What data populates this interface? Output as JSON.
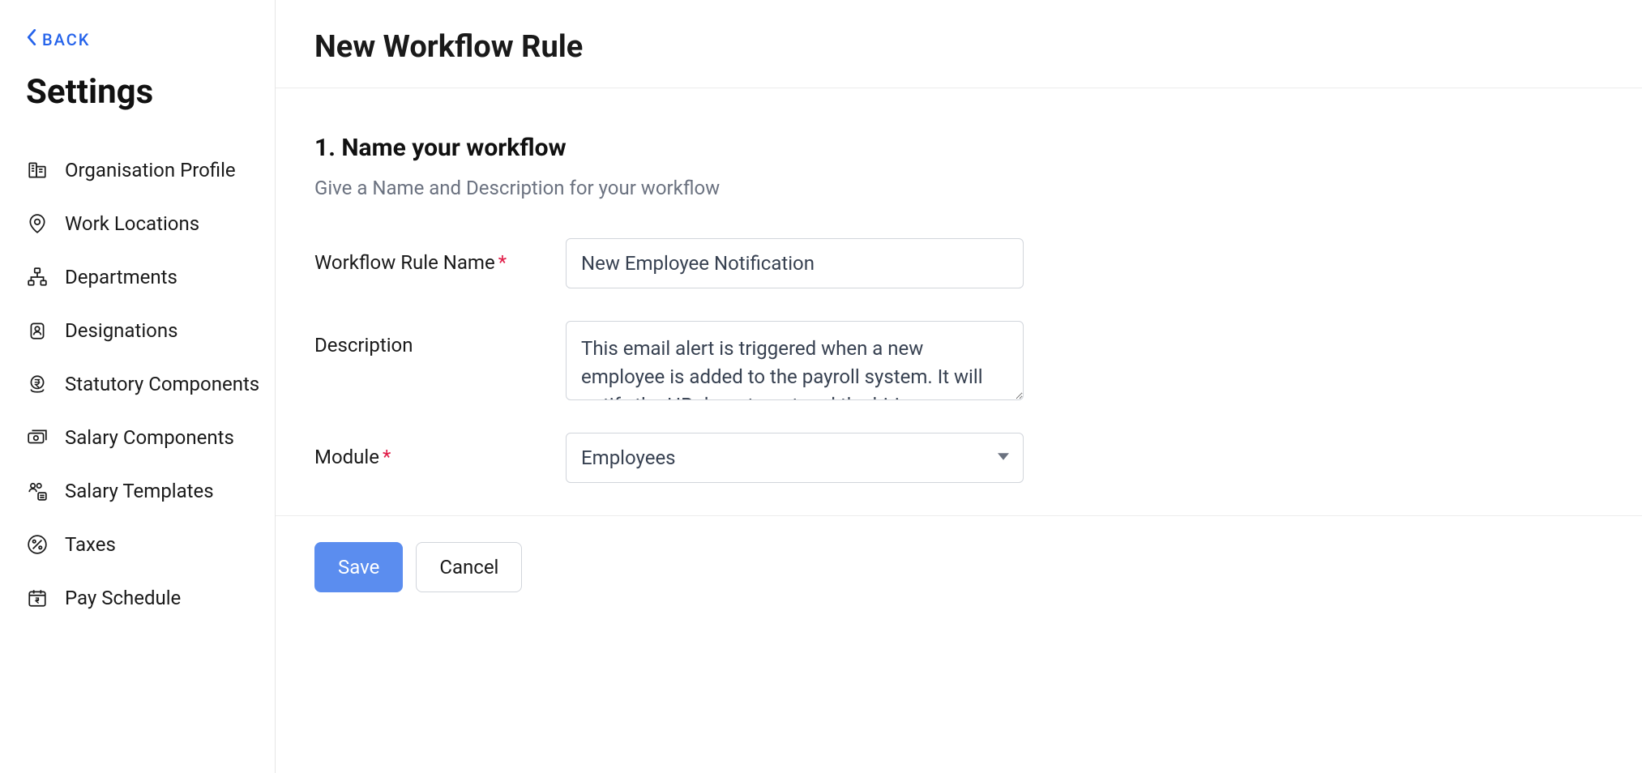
{
  "sidebar": {
    "back_label": "BACK",
    "title": "Settings",
    "items": [
      {
        "label": "Organisation Profile",
        "icon": "building-icon"
      },
      {
        "label": "Work Locations",
        "icon": "pin-icon"
      },
      {
        "label": "Departments",
        "icon": "org-chart-icon"
      },
      {
        "label": "Designations",
        "icon": "badge-icon"
      },
      {
        "label": "Statutory Components",
        "icon": "rupee-stamp-icon"
      },
      {
        "label": "Salary Components",
        "icon": "money-icon"
      },
      {
        "label": "Salary Templates",
        "icon": "people-list-icon"
      },
      {
        "label": "Taxes",
        "icon": "percent-icon"
      },
      {
        "label": "Pay Schedule",
        "icon": "calendar-rupee-icon"
      }
    ]
  },
  "main": {
    "page_title": "New Workflow Rule",
    "section_title": "1. Name your workflow",
    "section_subtitle": "Give a Name and Description for your workflow",
    "fields": {
      "name_label": "Workflow Rule Name",
      "name_value": "New Employee Notification",
      "description_label": "Description",
      "description_value": "This email alert is triggered when a new employee is added to the payroll system. It will notify the HR department and the hiring manager so that they",
      "module_label": "Module",
      "module_value": "Employees"
    },
    "buttons": {
      "save": "Save",
      "cancel": "Cancel"
    }
  }
}
